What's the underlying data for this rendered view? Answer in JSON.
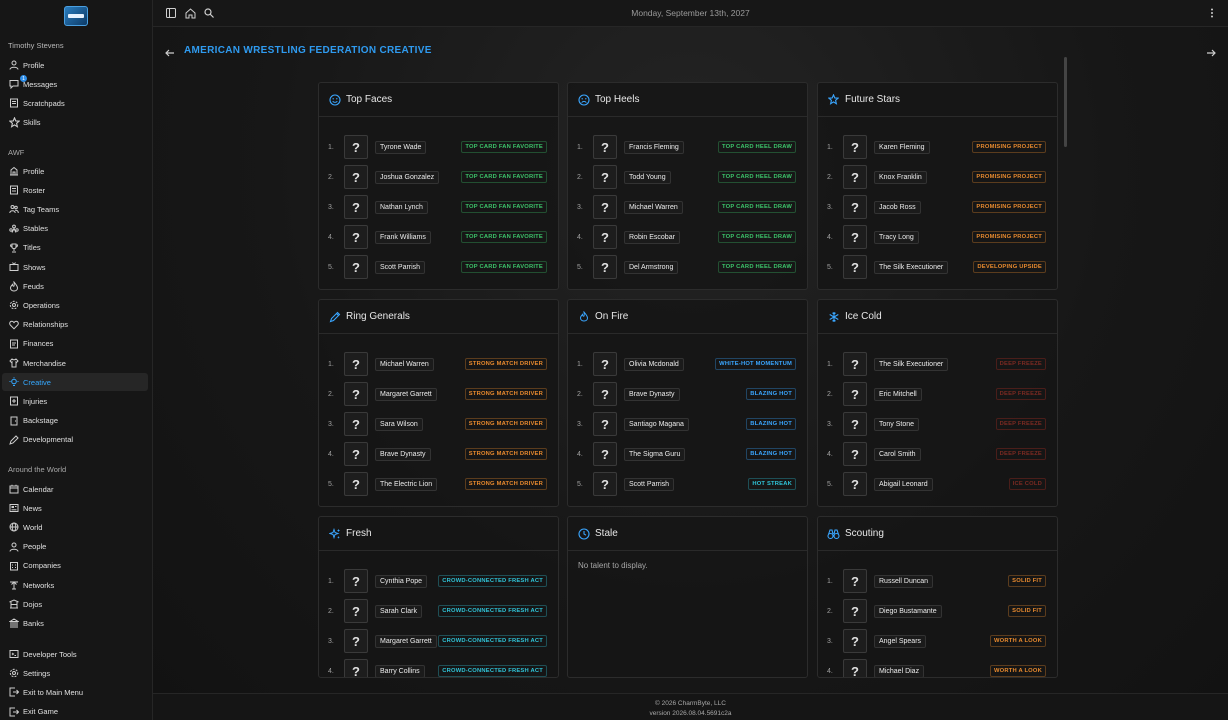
{
  "colors": {
    "accent": "#2f9bf0",
    "tag_green": "#3cc46a",
    "tag_orange": "#e88a2e",
    "tag_cyan": "#2fc4d8",
    "tag_blue": "#3aa6ff",
    "tag_red": "#c0392b"
  },
  "topbar": {
    "date": "Monday, September 13th, 2027",
    "icons": [
      "sidebar-toggle-icon",
      "home-icon",
      "search-icon",
      "more-vertical-icon"
    ]
  },
  "sidebar": {
    "user_name": "Timothy Stevens",
    "user_items": [
      {
        "label": "Profile",
        "icon": "person-icon"
      },
      {
        "label": "Messages",
        "icon": "chat-icon",
        "badge": "1"
      },
      {
        "label": "Scratchpads",
        "icon": "note-icon"
      },
      {
        "label": "Skills",
        "icon": "star-icon"
      }
    ],
    "org_label": "AWF",
    "org_items": [
      {
        "label": "Profile",
        "icon": "building-icon"
      },
      {
        "label": "Roster",
        "icon": "list-icon"
      },
      {
        "label": "Tag Teams",
        "icon": "team-icon"
      },
      {
        "label": "Stables",
        "icon": "group-icon"
      },
      {
        "label": "Titles",
        "icon": "trophy-icon"
      },
      {
        "label": "Shows",
        "icon": "tv-icon"
      },
      {
        "label": "Feuds",
        "icon": "flame-icon"
      },
      {
        "label": "Operations",
        "icon": "gear-icon"
      },
      {
        "label": "Relationships",
        "icon": "heart-icon"
      },
      {
        "label": "Finances",
        "icon": "money-icon"
      },
      {
        "label": "Merchandise",
        "icon": "shirt-icon"
      },
      {
        "label": "Creative",
        "icon": "bulb-icon",
        "active": true
      },
      {
        "label": "Injuries",
        "icon": "medical-icon"
      },
      {
        "label": "Backstage",
        "icon": "door-icon"
      },
      {
        "label": "Developmental",
        "icon": "pencil-icon"
      }
    ],
    "world_label": "Around the World",
    "world_items": [
      {
        "label": "Calendar",
        "icon": "calendar-icon"
      },
      {
        "label": "News",
        "icon": "news-icon"
      },
      {
        "label": "World",
        "icon": "globe-icon"
      },
      {
        "label": "People",
        "icon": "person-icon"
      },
      {
        "label": "Companies",
        "icon": "company-icon"
      },
      {
        "label": "Networks",
        "icon": "antenna-icon"
      },
      {
        "label": "Dojos",
        "icon": "dojo-icon"
      },
      {
        "label": "Banks",
        "icon": "bank-icon"
      }
    ],
    "bottom_items": [
      {
        "label": "Developer Tools",
        "icon": "code-icon"
      },
      {
        "label": "Settings",
        "icon": "gear-icon"
      },
      {
        "label": "Exit to Main Menu",
        "icon": "exit-icon"
      },
      {
        "label": "Exit Game",
        "icon": "power-icon"
      }
    ]
  },
  "main": {
    "title": "AMERICAN WRESTLING FEDERATION CREATIVE",
    "cards": [
      {
        "title": "Top Faces",
        "icon": "smile-icon",
        "rows": [
          {
            "rank": "1.",
            "name": "Tyrone Wade",
            "tag": "TOP CARD FAN FAVORITE",
            "color": "green"
          },
          {
            "rank": "2.",
            "name": "Joshua Gonzalez",
            "tag": "TOP CARD FAN FAVORITE",
            "color": "green"
          },
          {
            "rank": "3.",
            "name": "Nathan Lynch",
            "tag": "TOP CARD FAN FAVORITE",
            "color": "green"
          },
          {
            "rank": "4.",
            "name": "Frank Williams",
            "tag": "TOP CARD FAN FAVORITE",
            "color": "green"
          },
          {
            "rank": "5.",
            "name": "Scott Parrish",
            "tag": "TOP CARD FAN FAVORITE",
            "color": "green"
          }
        ]
      },
      {
        "title": "Top Heels",
        "icon": "frown-icon",
        "rows": [
          {
            "rank": "1.",
            "name": "Francis Fleming",
            "tag": "TOP CARD HEEL DRAW",
            "color": "green"
          },
          {
            "rank": "2.",
            "name": "Todd Young",
            "tag": "TOP CARD HEEL DRAW",
            "color": "green"
          },
          {
            "rank": "3.",
            "name": "Michael Warren",
            "tag": "TOP CARD HEEL DRAW",
            "color": "green"
          },
          {
            "rank": "4.",
            "name": "Robin Escobar",
            "tag": "TOP CARD HEEL DRAW",
            "color": "green"
          },
          {
            "rank": "5.",
            "name": "Del Armstrong",
            "tag": "TOP CARD HEEL DRAW",
            "color": "green"
          }
        ]
      },
      {
        "title": "Future Stars",
        "icon": "star-icon",
        "rows": [
          {
            "rank": "1.",
            "name": "Karen Fleming",
            "tag": "PROMISING PROJECT",
            "color": "orange"
          },
          {
            "rank": "2.",
            "name": "Knox Franklin",
            "tag": "PROMISING PROJECT",
            "color": "orange"
          },
          {
            "rank": "3.",
            "name": "Jacob Ross",
            "tag": "PROMISING PROJECT",
            "color": "orange"
          },
          {
            "rank": "4.",
            "name": "Tracy Long",
            "tag": "PROMISING PROJECT",
            "color": "orange"
          },
          {
            "rank": "5.",
            "name": "The Silk Executioner",
            "tag": "DEVELOPING UPSIDE",
            "color": "orange"
          }
        ]
      },
      {
        "title": "Ring Generals",
        "icon": "pen-icon",
        "rows": [
          {
            "rank": "1.",
            "name": "Michael Warren",
            "tag": "STRONG MATCH DRIVER",
            "color": "orange"
          },
          {
            "rank": "2.",
            "name": "Margaret Garrett",
            "tag": "STRONG MATCH DRIVER",
            "color": "orange"
          },
          {
            "rank": "3.",
            "name": "Sara Wilson",
            "tag": "STRONG MATCH DRIVER",
            "color": "orange"
          },
          {
            "rank": "4.",
            "name": "Brave Dynasty",
            "tag": "STRONG MATCH DRIVER",
            "color": "orange"
          },
          {
            "rank": "5.",
            "name": "The Electric Lion",
            "tag": "STRONG MATCH DRIVER",
            "color": "orange"
          }
        ]
      },
      {
        "title": "On Fire",
        "icon": "flame-icon",
        "rows": [
          {
            "rank": "1.",
            "name": "Olivia Mcdonald",
            "tag": "WHITE-HOT MOMENTUM",
            "color": "blue"
          },
          {
            "rank": "2.",
            "name": "Brave Dynasty",
            "tag": "BLAZING HOT",
            "color": "blue"
          },
          {
            "rank": "3.",
            "name": "Santiago Magana",
            "tag": "BLAZING HOT",
            "color": "blue"
          },
          {
            "rank": "4.",
            "name": "The Sigma Guru",
            "tag": "BLAZING HOT",
            "color": "blue"
          },
          {
            "rank": "5.",
            "name": "Scott Parrish",
            "tag": "HOT STREAK",
            "color": "cyan"
          }
        ]
      },
      {
        "title": "Ice Cold",
        "icon": "snowflake-icon",
        "rows": [
          {
            "rank": "1.",
            "name": "The Silk Executioner",
            "tag": "DEEP FREEZE",
            "color": "red"
          },
          {
            "rank": "2.",
            "name": "Eric Mitchell",
            "tag": "DEEP FREEZE",
            "color": "red"
          },
          {
            "rank": "3.",
            "name": "Tony Stone",
            "tag": "DEEP FREEZE",
            "color": "red"
          },
          {
            "rank": "4.",
            "name": "Carol Smith",
            "tag": "DEEP FREEZE",
            "color": "red"
          },
          {
            "rank": "5.",
            "name": "Abigail Leonard",
            "tag": "ICE COLD",
            "color": "red"
          }
        ]
      },
      {
        "title": "Fresh",
        "icon": "sparkle-icon",
        "rows": [
          {
            "rank": "1.",
            "name": "Cynthia Pope",
            "tag": "CROWD-CONNECTED FRESH ACT",
            "color": "cyan"
          },
          {
            "rank": "2.",
            "name": "Sarah Clark",
            "tag": "CROWD-CONNECTED FRESH ACT",
            "color": "cyan"
          },
          {
            "rank": "3.",
            "name": "Margaret Garrett",
            "tag": "CROWD-CONNECTED FRESH ACT",
            "color": "cyan"
          },
          {
            "rank": "4.",
            "name": "Barry Collins",
            "tag": "CROWD-CONNECTED FRESH ACT",
            "color": "cyan"
          }
        ]
      },
      {
        "title": "Stale",
        "icon": "clock-icon",
        "empty": "No talent to display.",
        "rows": []
      },
      {
        "title": "Scouting",
        "icon": "binoculars-icon",
        "rows": [
          {
            "rank": "1.",
            "name": "Russell Duncan",
            "tag": "SOLID FIT",
            "color": "orange"
          },
          {
            "rank": "2.",
            "name": "Diego Bustamante",
            "tag": "SOLID FIT",
            "color": "orange"
          },
          {
            "rank": "3.",
            "name": "Angel Spears",
            "tag": "WORTH A LOOK",
            "color": "orange"
          },
          {
            "rank": "4.",
            "name": "Michael Diaz",
            "tag": "WORTH A LOOK",
            "color": "orange"
          }
        ]
      }
    ]
  },
  "footer": {
    "copyright": "© 2026 CharmByte, LLC",
    "version": "version 2026.08.04.5691c2a"
  }
}
